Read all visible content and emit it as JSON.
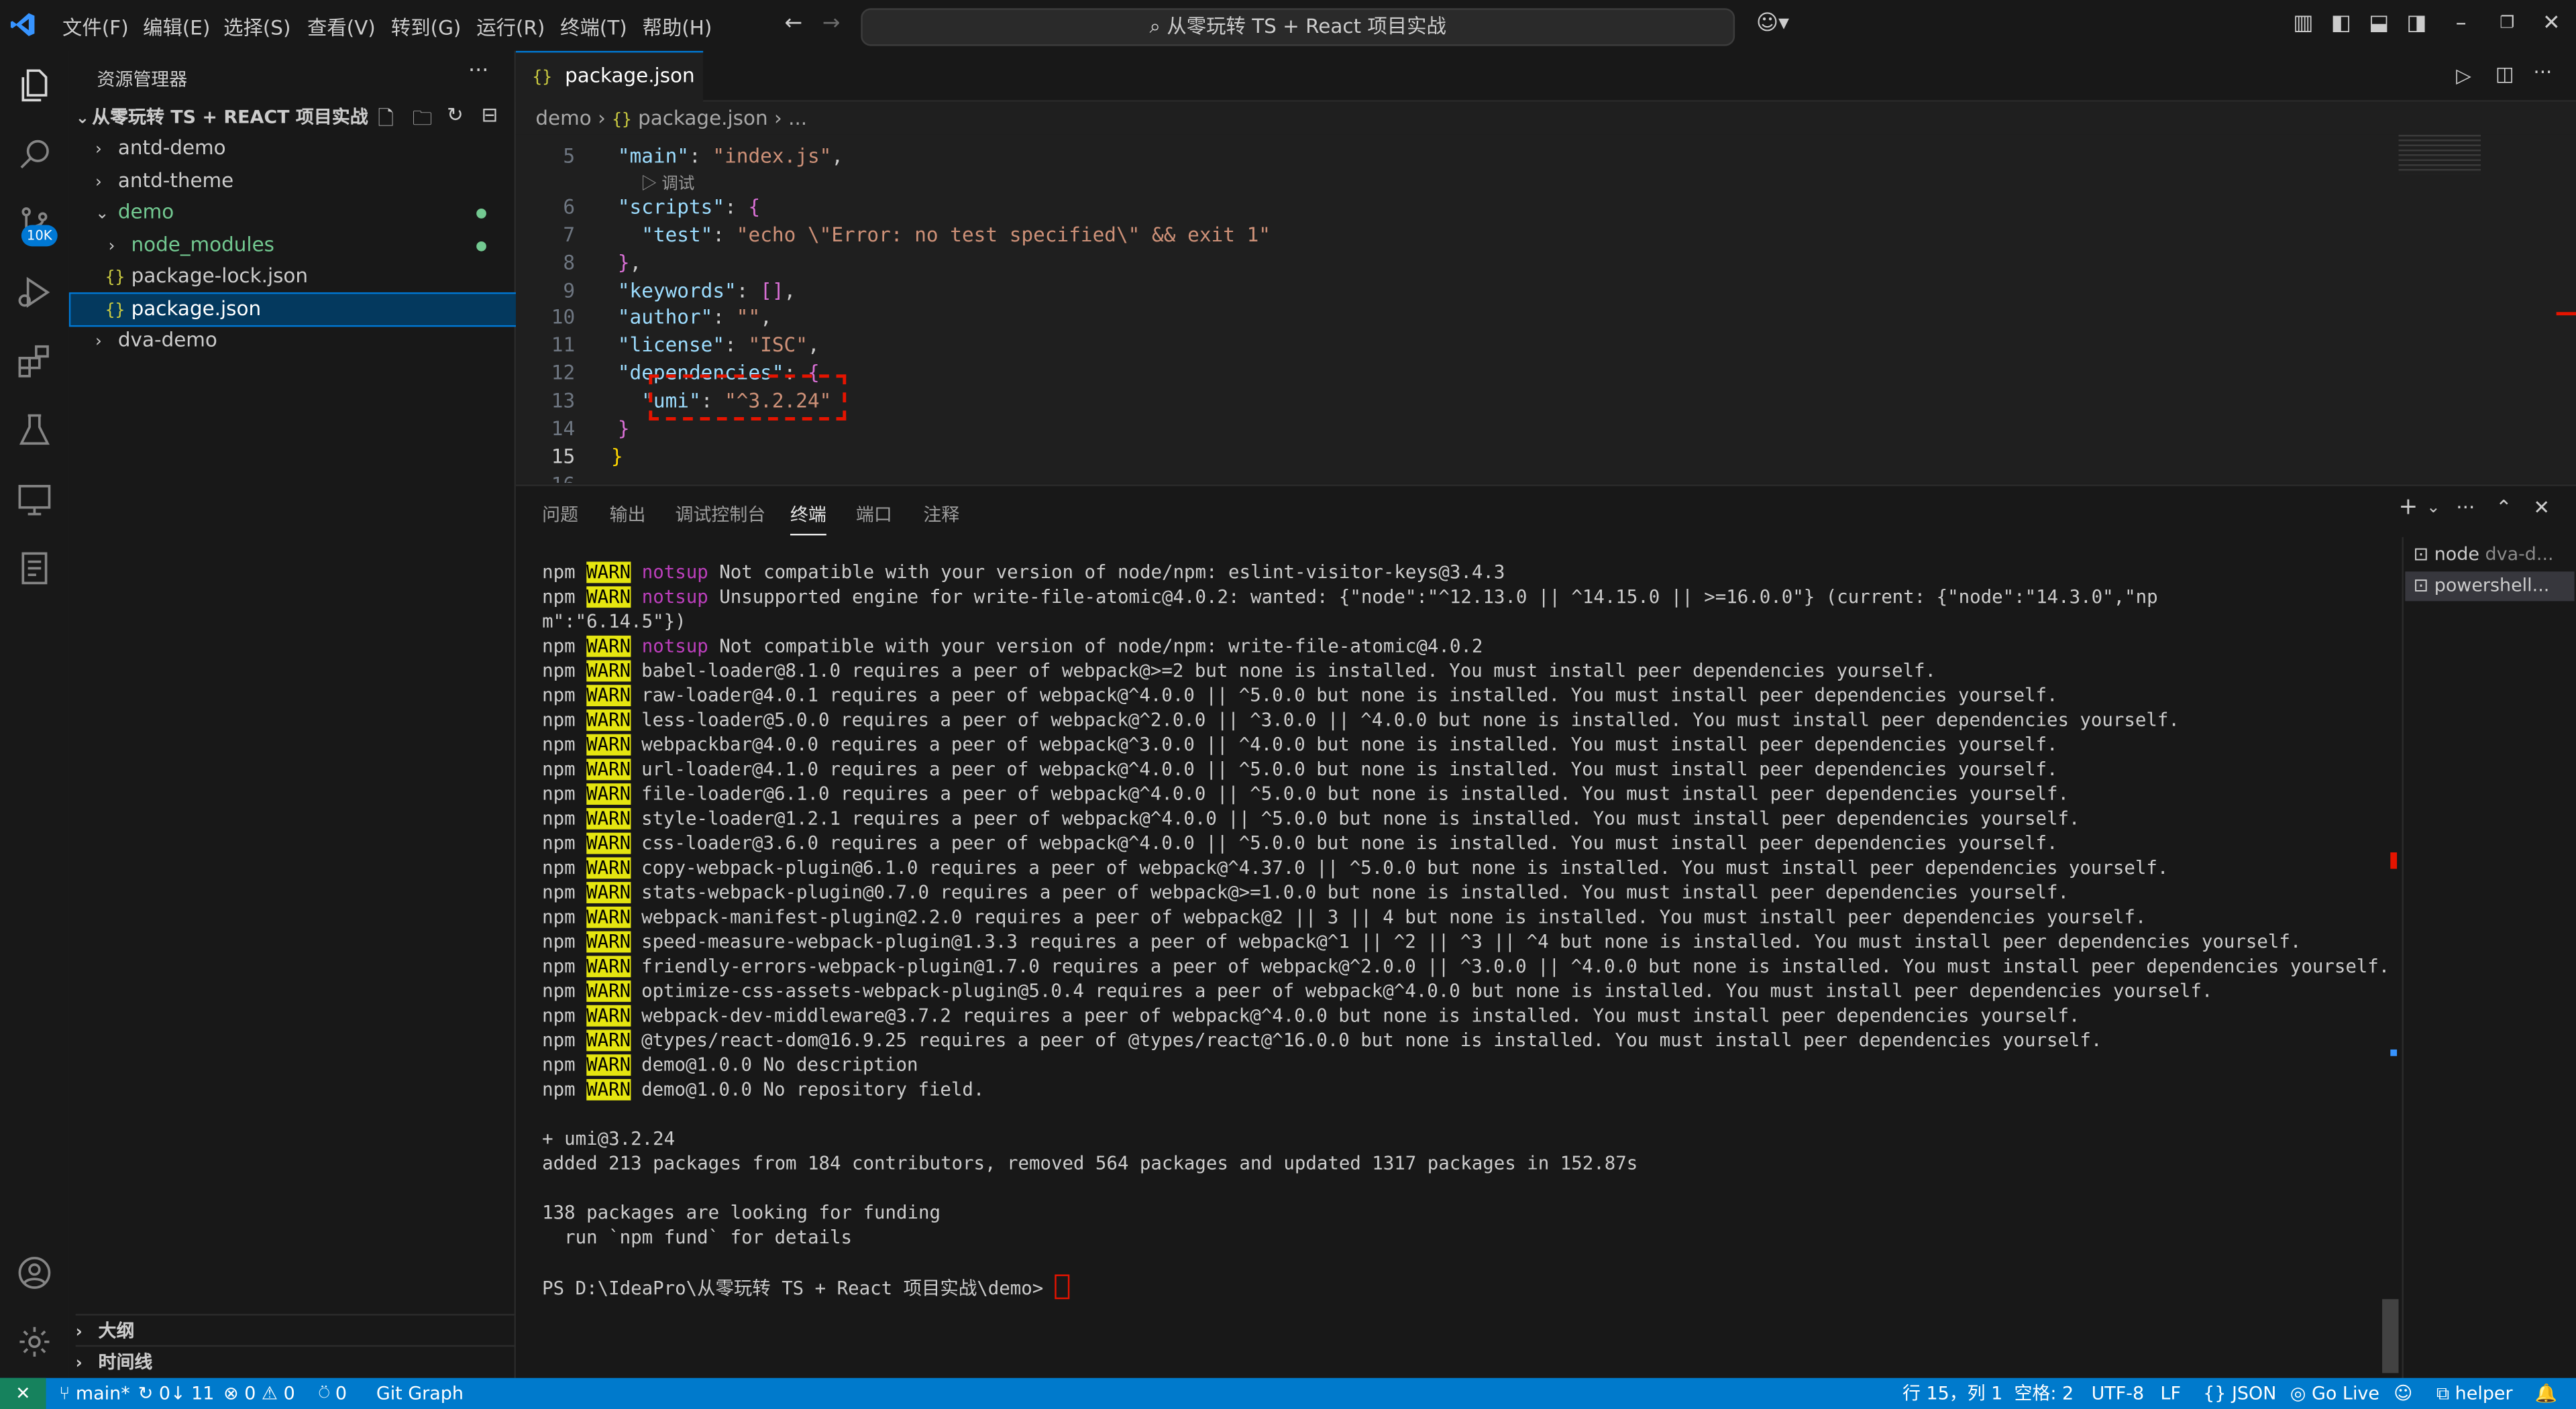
{
  "menu": [
    "文件(F)",
    "编辑(E)",
    "选择(S)",
    "查看(V)",
    "转到(G)",
    "运行(R)",
    "终端(T)",
    "帮助(H)"
  ],
  "command_center": "从零玩转 TS + React 项目实战",
  "explorer": {
    "title": "资源管理器",
    "root": "从零玩转 TS + REACT 项目实战",
    "items": [
      "antd-demo",
      "antd-theme",
      "demo",
      "node_modules",
      "package-lock.json",
      "package.json",
      "dva-demo"
    ],
    "outline": "大纲",
    "timeline": "时间线"
  },
  "badge": "10K",
  "editor": {
    "tab": "package.json",
    "breadcrumb": [
      "demo",
      "package.json",
      "..."
    ],
    "codelens": "调试",
    "line_numbers": [
      "5",
      "6",
      "7",
      "8",
      "9",
      "10",
      "11",
      "12",
      "13",
      "14",
      "15",
      "16"
    ],
    "lines": {
      "main_key": "\"main\"",
      "main_val": "\"index.js\"",
      "scripts_key": "\"scripts\"",
      "test_key": "\"test\"",
      "test_val": "\"echo \\\"Error: no test specified\\\" && exit 1\"",
      "keywords_key": "\"keywords\"",
      "author_key": "\"author\"",
      "author_val": "\"\"",
      "license_key": "\"license\"",
      "license_val": "\"ISC\"",
      "deps_key": "\"dependencies\"",
      "umi_key": "\"umi\"",
      "umi_val": "\"^3.2.24\""
    }
  },
  "panel": {
    "tabs": [
      "问题",
      "输出",
      "调试控制台",
      "终端",
      "端口",
      "注释"
    ],
    "terminals": [
      "node",
      "dva-d...",
      "powershell..."
    ],
    "lines": [
      {
        "w": true,
        "n": "notsup",
        "t": " Not compatible with your version of node/npm: eslint-visitor-keys@3.4.3"
      },
      {
        "w": true,
        "n": "notsup",
        "t": " Unsupported engine for write-file-atomic@4.0.2: wanted: {\"node\":\"^12.13.0 || ^14.15.0 || >=16.0.0\"} (current: {\"node\":\"14.3.0\",\"np"
      },
      {
        "raw": "m\":\"6.14.5\"})"
      },
      {
        "w": true,
        "n": "notsup",
        "t": " Not compatible with your version of node/npm: write-file-atomic@4.0.2"
      },
      {
        "w": true,
        "t": " babel-loader@8.1.0 requires a peer of webpack@>=2 but none is installed. You must install peer dependencies yourself."
      },
      {
        "w": true,
        "t": " raw-loader@4.0.1 requires a peer of webpack@^4.0.0 || ^5.0.0 but none is installed. You must install peer dependencies yourself."
      },
      {
        "w": true,
        "t": " less-loader@5.0.0 requires a peer of webpack@^2.0.0 || ^3.0.0 || ^4.0.0 but none is installed. You must install peer dependencies yourself."
      },
      {
        "w": true,
        "t": " webpackbar@4.0.0 requires a peer of webpack@^3.0.0 || ^4.0.0 but none is installed. You must install peer dependencies yourself."
      },
      {
        "w": true,
        "t": " url-loader@4.1.0 requires a peer of webpack@^4.0.0 || ^5.0.0 but none is installed. You must install peer dependencies yourself."
      },
      {
        "w": true,
        "t": " file-loader@6.1.0 requires a peer of webpack@^4.0.0 || ^5.0.0 but none is installed. You must install peer dependencies yourself."
      },
      {
        "w": true,
        "t": " style-loader@1.2.1 requires a peer of webpack@^4.0.0 || ^5.0.0 but none is installed. You must install peer dependencies yourself."
      },
      {
        "w": true,
        "t": " css-loader@3.6.0 requires a peer of webpack@^4.0.0 || ^5.0.0 but none is installed. You must install peer dependencies yourself."
      },
      {
        "w": true,
        "t": " copy-webpack-plugin@6.1.0 requires a peer of webpack@^4.37.0 || ^5.0.0 but none is installed. You must install peer dependencies yourself."
      },
      {
        "w": true,
        "t": " stats-webpack-plugin@0.7.0 requires a peer of webpack@>=1.0.0 but none is installed. You must install peer dependencies yourself."
      },
      {
        "w": true,
        "t": " webpack-manifest-plugin@2.2.0 requires a peer of webpack@2 || 3 || 4 but none is installed. You must install peer dependencies yourself."
      },
      {
        "w": true,
        "t": " speed-measure-webpack-plugin@1.3.3 requires a peer of webpack@^1 || ^2 || ^3 || ^4 but none is installed. You must install peer dependencies yourself."
      },
      {
        "w": true,
        "t": " friendly-errors-webpack-plugin@1.7.0 requires a peer of webpack@^2.0.0 || ^3.0.0 || ^4.0.0 but none is installed. You must install peer dependencies yourself."
      },
      {
        "w": true,
        "t": " optimize-css-assets-webpack-plugin@5.0.4 requires a peer of webpack@^4.0.0 but none is installed. You must install peer dependencies yourself."
      },
      {
        "w": true,
        "t": " webpack-dev-middleware@3.7.2 requires a peer of webpack@^4.0.0 but none is installed. You must install peer dependencies yourself."
      },
      {
        "w": true,
        "t": " @types/react-dom@16.9.25 requires a peer of @types/react@^16.0.0 but none is installed. You must install peer dependencies yourself."
      },
      {
        "w": true,
        "t": " demo@1.0.0 No description"
      },
      {
        "w": true,
        "t": " demo@1.0.0 No repository field."
      },
      {
        "raw": ""
      },
      {
        "raw": "+ umi@3.2.24"
      },
      {
        "raw": "added 213 packages from 184 contributors, removed 564 packages and updated 1317 packages in 152.87s"
      },
      {
        "raw": ""
      },
      {
        "raw": "138 packages are looking for funding"
      },
      {
        "raw": "  run `npm fund` for details"
      },
      {
        "raw": ""
      },
      {
        "raw": "PS D:\\IdeaPro\\从零玩转 TS + React 项目实战\\demo> "
      }
    ]
  },
  "statusbar": {
    "branch": "main*",
    "sync": "0↓ 11",
    "problems": "0",
    "warnings": "0",
    "ports": "0",
    "git_graph": "Git Graph",
    "position": "行 15，列 1",
    "spaces": "空格: 2",
    "encoding": "UTF-8",
    "eol": "LF",
    "language": "JSON",
    "go_live": "Go Live",
    "helper": "helper"
  },
  "colors": {
    "accent": "#007acc",
    "warn_bg": "#e5e510",
    "highlight": "#e51400"
  }
}
